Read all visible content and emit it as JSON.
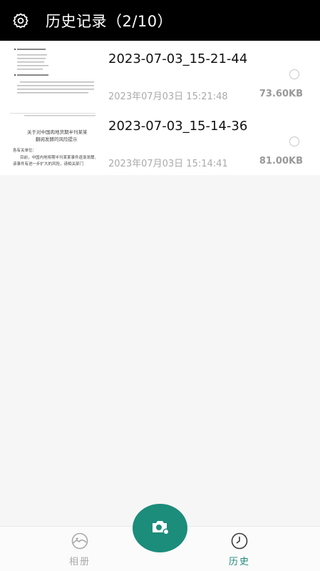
{
  "header": {
    "title": "历史记录（2/10）",
    "icon": "gear-icon"
  },
  "records": [
    {
      "name": "2023-07-03_15-21-44",
      "date": "2023年07月03日 15:21:48",
      "size": "73.60KB"
    },
    {
      "name": "2023-07-03_15-14-36",
      "date": "2023年07月03日 15:14:41",
      "size": "81.00KB",
      "thumb_heading1": "关于对中国肉地货期半刊某某",
      "thumb_heading2": "翻阅发酵的风险提示",
      "thumb_line1": "各有关单位：",
      "thumb_line2": "目前，中国内地将期半刊某某事件逐渐发酵，",
      "thumb_line3": "该事件有进一步扩大的风险，请相关部门"
    }
  ],
  "nav": {
    "album_label": "相册",
    "history_label": "历史"
  },
  "colors": {
    "accent": "#1c8c7b",
    "header_bg": "#000000"
  }
}
